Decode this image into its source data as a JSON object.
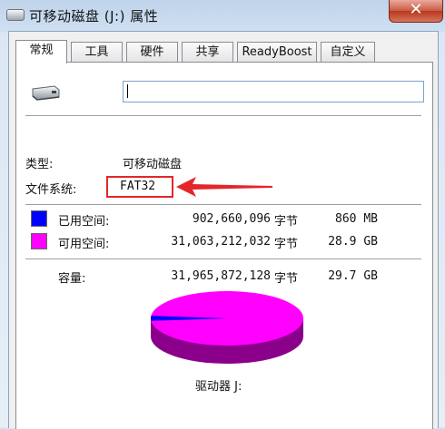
{
  "window": {
    "title": "可移动磁盘 (J:) 属性",
    "close_glyph": "✕"
  },
  "tabs": [
    {
      "label": "常规",
      "active": true
    },
    {
      "label": "工具",
      "active": false
    },
    {
      "label": "硬件",
      "active": false
    },
    {
      "label": "共享",
      "active": false
    },
    {
      "label": "ReadyBoost",
      "active": false
    },
    {
      "label": "自定义",
      "active": false
    }
  ],
  "general": {
    "volume_name": "",
    "type_label": "类型:",
    "type_value": "可移动磁盘",
    "fs_label": "文件系统:",
    "fs_value": "FAT32",
    "used_label": "已用空间:",
    "used_bytes": "902,660,096",
    "used_unit": "字节",
    "used_size": "860 MB",
    "free_label": "可用空间:",
    "free_bytes": "31,063,212,032",
    "free_unit": "字节",
    "free_size": "28.9 GB",
    "capacity_label": "容量:",
    "capacity_bytes": "31,965,872,128",
    "capacity_unit": "字节",
    "capacity_size": "29.7 GB",
    "drive_label": "驱动器 J:"
  },
  "colors": {
    "used": "#0000ff",
    "free": "#ff00ff",
    "highlight": "#e4262a"
  },
  "disk_usage": {
    "used_fraction": 0.0282
  }
}
